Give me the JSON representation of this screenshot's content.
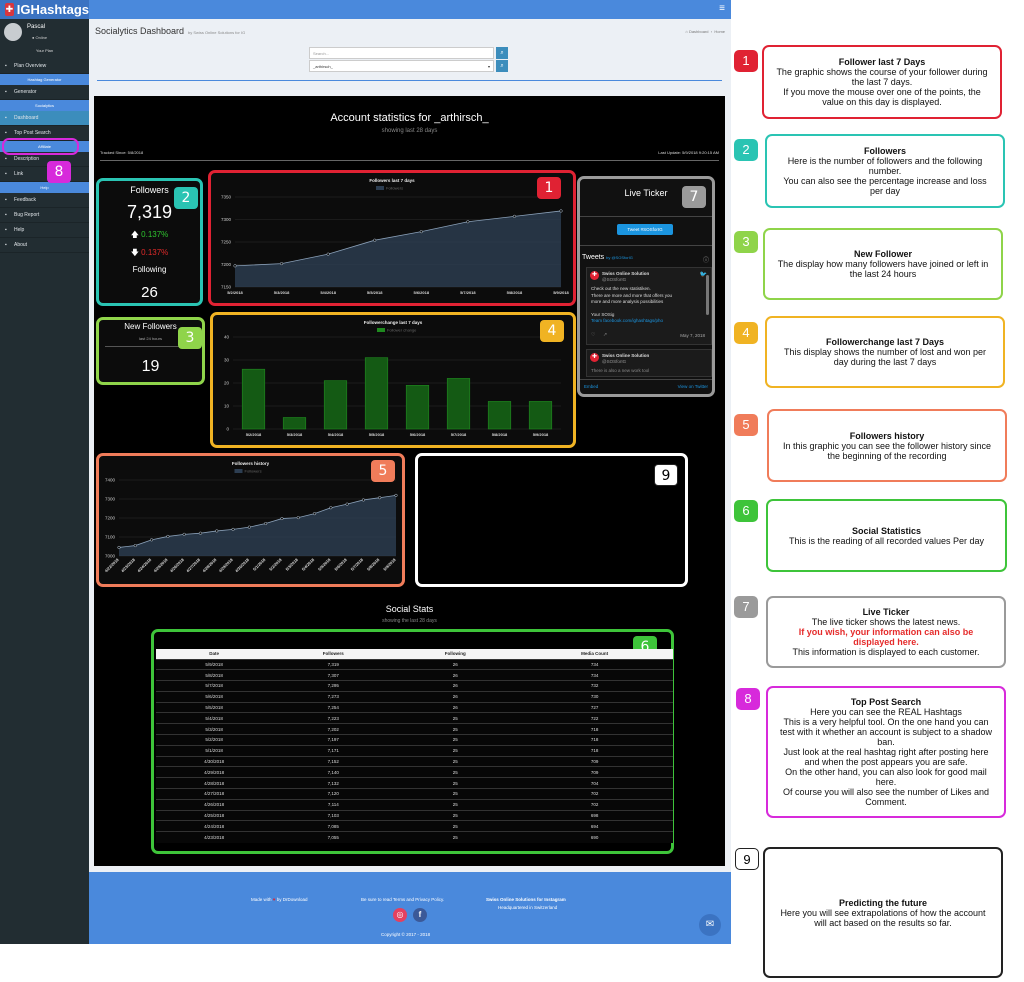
{
  "app": {
    "logo_text": "IGHashtags",
    "menu_icon": "hamburger-icon"
  },
  "user": {
    "name": "Pascal",
    "status": "Online",
    "plan": "Your Plan"
  },
  "sidebar": {
    "items": [
      {
        "label": "Plan Overview",
        "icon": "plan-icon"
      },
      {
        "header": "Hashtag Generator"
      },
      {
        "label": "Generator",
        "icon": "generator-icon"
      },
      {
        "header": "Socialytics"
      },
      {
        "label": "Dashboard",
        "icon": "dashboard-icon",
        "active": true
      },
      {
        "label": "Top Post Search",
        "icon": "search-icon"
      },
      {
        "header": "Affiliate"
      },
      {
        "label": "Description",
        "icon": "description-icon"
      },
      {
        "label": "Link",
        "icon": "link-icon"
      },
      {
        "header": "Help"
      },
      {
        "label": "Feedback",
        "icon": "feedback-icon"
      },
      {
        "label": "Bug Report",
        "icon": "bug-icon"
      },
      {
        "label": "Help",
        "icon": "help-icon"
      },
      {
        "label": "About",
        "icon": "info-icon"
      }
    ]
  },
  "header": {
    "title": "Socialytics Dashboard",
    "subtitle": "by Swiss Online Solutions for IG",
    "crumb_home": "Dashboard",
    "crumb_sep": "›",
    "crumb_current": "Home"
  },
  "search": {
    "placeholder": "Search...",
    "selected": "_arthirsch_"
  },
  "account": {
    "title": "Account statistics for _arthirsch_",
    "subtitle": "showing last 28 days",
    "tracked": "Tracked Since: 5/8/2018",
    "last_update": "Last Update: 5/9/2018 9:20:15 AM"
  },
  "followers_box": {
    "title": "Followers",
    "count": "7,319",
    "up_pct": "0.137%",
    "down_pct": "0.137%",
    "following_label": "Following",
    "following": "26"
  },
  "new_followers_box": {
    "title": "New Followers",
    "sub": "last 24 hours",
    "count": "19"
  },
  "ticker": {
    "title": "Live Ticker",
    "tweet_button": "Tweet #SOSforIG",
    "tweets_label": "Tweets",
    "tweets_by": "by @SOSforIG",
    "author": "Swiss Online Solution",
    "handle": "@SOSforIG",
    "line1": "Check out the new statistiken.",
    "line2": "There are more and more that offers you",
    "line3": "more and more analysis possibilities",
    "line4": "Your SOSig",
    "line5": "Team facebook.com/ighashtags/pho",
    "date": "May 7, 2018",
    "author2": "Swiss Online Solution",
    "handle2": "@SOSforIG",
    "line6": "There is also a new work tool",
    "embed": "Embed",
    "view": "View on Twitter"
  },
  "social_stats": {
    "title": "Social Stats",
    "subtitle": "showing the last 28 days"
  },
  "chart_data": [
    {
      "type": "line",
      "title": "Followers last 7 days",
      "legend": "Followers",
      "categories": [
        "5/2/2018",
        "5/3/2018",
        "5/4/2018",
        "5/5/2018",
        "5/6/2018",
        "5/7/2018",
        "5/8/2018",
        "5/9/2018"
      ],
      "values": [
        7197,
        7202,
        7223,
        7254,
        7273,
        7295,
        7307,
        7319
      ],
      "yticks": [
        7150,
        7200,
        7250,
        7300,
        7350
      ],
      "ylim": [
        7150,
        7350
      ]
    },
    {
      "type": "bar",
      "title": "Followerchange last 7 days",
      "legend": "Follower change",
      "categories": [
        "5/2/2018",
        "5/3/2018",
        "5/4/2018",
        "5/5/2018",
        "5/6/2018",
        "5/7/2018",
        "5/8/2018",
        "5/9/2018"
      ],
      "values": [
        26,
        5,
        21,
        31,
        19,
        22,
        12,
        12
      ],
      "yticks": [
        0,
        10,
        20,
        30,
        40
      ],
      "ylim": [
        0,
        40
      ]
    },
    {
      "type": "area",
      "title": "Followers history",
      "legend": "Followers",
      "categories": [
        "4/22/2018",
        "4/23/2018",
        "4/24/2018",
        "4/25/2018",
        "4/26/2018",
        "4/27/2018",
        "4/28/2018",
        "4/29/2018",
        "4/30/2018",
        "5/1/2018",
        "5/2/2018",
        "5/3/2018",
        "5/4/2018",
        "5/5/2018",
        "5/6/2018",
        "5/7/2018",
        "5/8/2018",
        "5/9/2018"
      ],
      "values": [
        7045,
        7055,
        7085,
        7103,
        7114,
        7120,
        7132,
        7140,
        7152,
        7171,
        7197,
        7202,
        7223,
        7254,
        7273,
        7295,
        7307,
        7319
      ],
      "yticks": [
        7000,
        7100,
        7200,
        7300,
        7400
      ],
      "ylim": [
        7000,
        7400
      ]
    }
  ],
  "table": {
    "headers": [
      "Date",
      "Followers",
      "Following",
      "Media Count"
    ],
    "rows": [
      [
        "5/9/2018",
        "7,319",
        "26",
        "734"
      ],
      [
        "5/8/2018",
        "7,307",
        "26",
        "734"
      ],
      [
        "5/7/2018",
        "7,295",
        "26",
        "732"
      ],
      [
        "5/6/2018",
        "7,273",
        "26",
        "730"
      ],
      [
        "5/5/2018",
        "7,254",
        "26",
        "727"
      ],
      [
        "5/4/2018",
        "7,223",
        "25",
        "722"
      ],
      [
        "5/3/2018",
        "7,202",
        "25",
        "718"
      ],
      [
        "5/2/2018",
        "7,197",
        "25",
        "718"
      ],
      [
        "5/1/2018",
        "7,171",
        "25",
        "718"
      ],
      [
        "4/30/2018",
        "7,152",
        "25",
        "709"
      ],
      [
        "4/29/2018",
        "7,140",
        "25",
        "709"
      ],
      [
        "4/28/2018",
        "7,132",
        "25",
        "704"
      ],
      [
        "4/27/2018",
        "7,120",
        "25",
        "702"
      ],
      [
        "4/26/2018",
        "7,114",
        "25",
        "702"
      ],
      [
        "4/25/2018",
        "7,103",
        "25",
        "698"
      ],
      [
        "4/24/2018",
        "7,085",
        "25",
        "694"
      ],
      [
        "4/23/2018",
        "7,055",
        "25",
        "690"
      ]
    ]
  },
  "footer": {
    "made_with": "Made with",
    "heart": "♥",
    "by": "by DrDownload",
    "terms": "Be sure to read Terms and Privacy Policy.",
    "company": "Swiss Online Solutions for Instagram",
    "hq": "Headquartered in Switzerland",
    "copyright": "Copyright © 2017 - 2018"
  },
  "badges": {
    "b1": "1",
    "b2": "2",
    "b3": "3",
    "b4": "4",
    "b5": "5",
    "b6": "6",
    "b7": "7",
    "b8": "8",
    "b9": "9"
  },
  "colors": {
    "c1": "#e02233",
    "c2": "#2ac4b3",
    "c3": "#8fd44a",
    "c4": "#f0b323",
    "c5": "#f07c5a",
    "c6": "#3ec43a",
    "c7": "#9a9a9a",
    "c8": "#d72adb",
    "c9": "#ffffff"
  },
  "legend": [
    {
      "num": "1",
      "title": "Follower last 7 Days",
      "desc": [
        "The graphic shows the course of your follower during",
        "the last 7 days.",
        "If you move the mouse over one of the points, the",
        "value on this day is displayed."
      ]
    },
    {
      "num": "2",
      "title": "Followers",
      "desc": [
        "Here is the number of followers and the following",
        "number.",
        "You can also see the percentage increase and loss",
        "per day"
      ]
    },
    {
      "num": "3",
      "title": "New Follower",
      "desc": [
        "The display how many followers have joined or left in",
        "the last 24 hours"
      ]
    },
    {
      "num": "4",
      "title": "Followerchange last 7 Days",
      "desc": [
        "This display shows the number of lost and won per",
        "day during the last 7 days"
      ]
    },
    {
      "num": "5",
      "title": "Followers history",
      "desc": [
        "In this graphic you can see the follower history since",
        "the beginning of the recording"
      ]
    },
    {
      "num": "6",
      "title": "Social Statistics",
      "desc": [
        "This is the reading of all recorded values Per day"
      ]
    },
    {
      "num": "7",
      "title": "Live Ticker",
      "desc": [
        "The live ticker shows the latest news."
      ],
      "red": [
        "If you wish, your information can also be",
        "displayed here."
      ],
      "desc2": [
        "This information is displayed to each customer."
      ]
    },
    {
      "num": "8",
      "title": "Top Post Search",
      "desc": [
        "Here you can see the REAL Hashtags",
        "This is a very helpful tool. On the one hand you can",
        "test with it whether an account is subject to a shadow",
        "ban.",
        "Just look at the real hashtag right after posting here",
        "and when the post appears you are safe.",
        "On the other hand, you can also look for good mail",
        "here.",
        "Of course you will also see the number of Likes and",
        "Comment."
      ]
    },
    {
      "num": "9",
      "title": "Predicting the future",
      "desc": [
        "Here you will see extrapolations of how the account",
        "will act based on the results so far."
      ]
    }
  ]
}
